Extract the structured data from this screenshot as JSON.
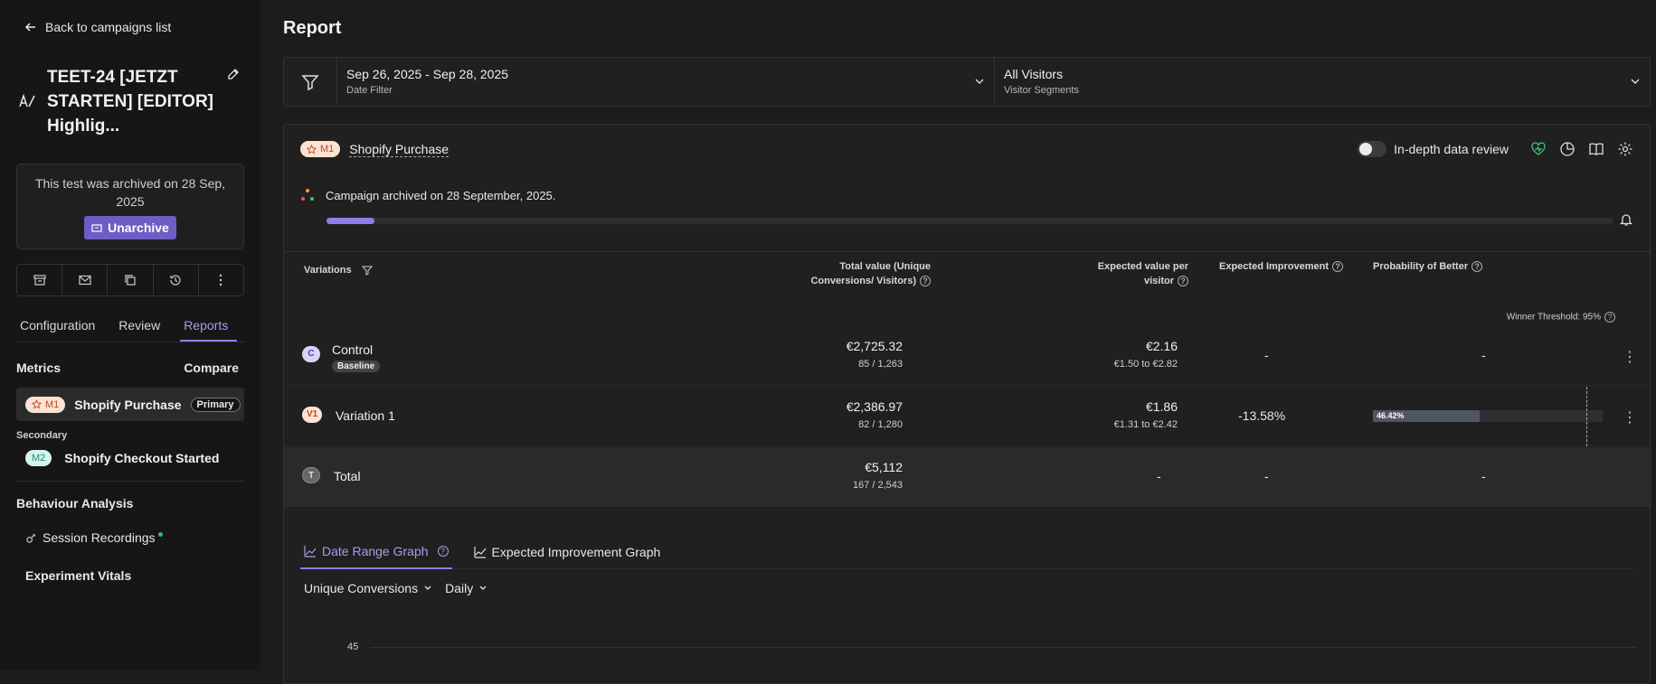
{
  "sidebar": {
    "back_label": "Back to campaigns list",
    "title": "TEET-24 [JETZT STARTEN] [EDITOR] Highlig...",
    "archived_text": "This test was archived on 28 Sep, 2025",
    "unarchive_label": "Unarchive",
    "tabs": [
      {
        "label": "Configuration",
        "active": false
      },
      {
        "label": "Review",
        "active": false
      },
      {
        "label": "Reports",
        "active": true
      }
    ],
    "metrics_label": "Metrics",
    "compare_label": "Compare",
    "primary_metric": {
      "badge": "M1",
      "name": "Shopify Purchase",
      "tag": "Primary"
    },
    "secondary_label": "Secondary",
    "secondary_metric": {
      "badge": "M2",
      "name": "Shopify Checkout Started"
    },
    "behaviour_label": "Behaviour Analysis",
    "session_recordings": "Session Recordings",
    "experiment_vitals": "Experiment Vitals"
  },
  "report": {
    "title": "Report",
    "date_filter": {
      "value": "Sep 26, 2025 - Sep 28, 2025",
      "label": "Date Filter"
    },
    "segment_filter": {
      "value": "All Visitors",
      "label": "Visitor Segments"
    },
    "metric_badge": "M1",
    "metric_name": "Shopify Purchase",
    "in_depth_label": "In-depth data review",
    "archived_message": "Campaign archived on 28 September, 2025.",
    "progress": 0.037,
    "columns": {
      "variations": "Variations",
      "total_value": "Total value (Unique Conversions/ Visitors)",
      "expected_value": "Expected value per visitor",
      "expected_improvement": "Expected Improvement",
      "probability": "Probability of Better"
    },
    "winner_threshold": "Winner Threshold: 95%",
    "rows": [
      {
        "badge": "C",
        "name": "Control",
        "tag": "Baseline",
        "total": "€2,725.32",
        "ratio": "85 / 1,263",
        "epv": "€2.16",
        "epv_range": "€1.50 to €2.82",
        "improvement": "-",
        "probability": "-"
      },
      {
        "badge": "V1",
        "name": "Variation 1",
        "total": "€2,386.97",
        "ratio": "82 / 1,280",
        "epv": "€1.86",
        "epv_range": "€1.31 to €2.42",
        "improvement": "-13.58%",
        "probability": "46.42%",
        "probability_value": 0.4642
      },
      {
        "badge": "T",
        "name": "Total",
        "total": "€5,112",
        "ratio": "167 / 2,543",
        "epv": "-",
        "improvement": "-",
        "probability": "-"
      }
    ],
    "graph_tabs": [
      "Date Range Graph",
      "Expected Improvement Graph"
    ],
    "metric_select": "Unique Conversions",
    "interval_select": "Daily",
    "y_tick": "45"
  }
}
